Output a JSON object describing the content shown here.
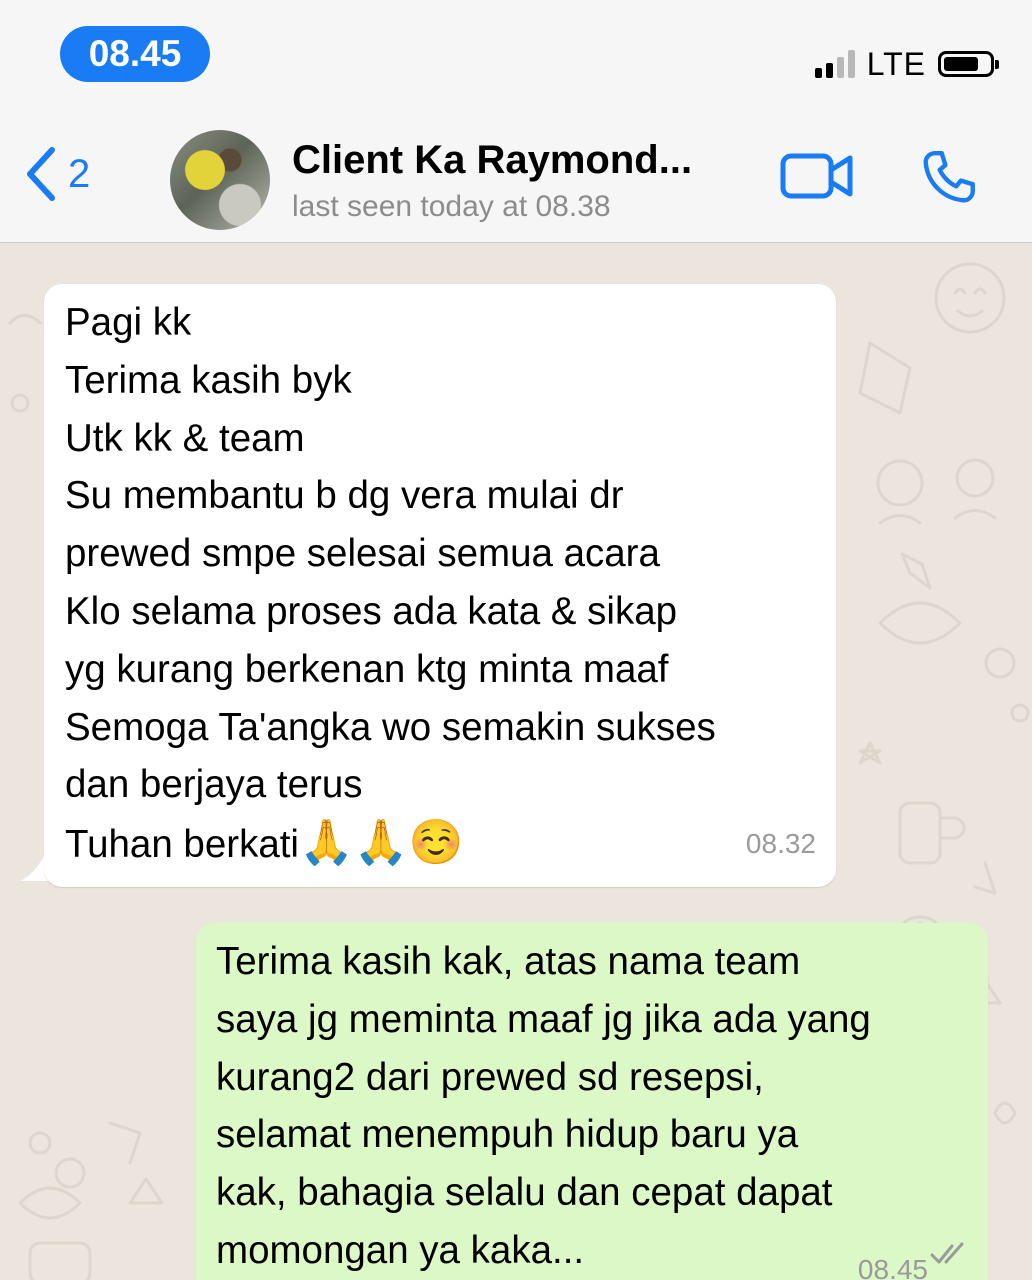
{
  "status_bar": {
    "time": "08.45",
    "network": "LTE",
    "signal_bars": 2,
    "signal_total": 4
  },
  "header": {
    "back_count": "2",
    "contact_name": "Client Ka Raymond...",
    "last_seen": "last seen today at 08.38",
    "accent_color": "#1a7cf5"
  },
  "messages": [
    {
      "direction": "incoming",
      "lines": [
        "Pagi kk",
        "Terima kasih byk",
        "Utk kk & team",
        "Su membantu b dg vera mulai dr",
        "prewed smpe selesai semua acara",
        "Klo selama proses ada kata & sikap",
        "yg kurang berkenan ktg minta maaf",
        "Semoga Ta'angka wo semakin sukses",
        "dan berjaya terus",
        "Tuhan berkati"
      ],
      "emoji": "🙏🙏☺️",
      "time": "08.32"
    },
    {
      "direction": "outgoing",
      "lines": [
        "Terima kasih kak, atas nama team",
        "saya jg meminta maaf jg jika ada yang",
        "kurang2 dari prewed sd resepsi,",
        "selamat menempuh hidup baru ya",
        "kak, bahagia selalu dan cepat dapat",
        "momongan ya kaka..."
      ],
      "time": "08.45",
      "read_status": "double-check-icon"
    }
  ]
}
